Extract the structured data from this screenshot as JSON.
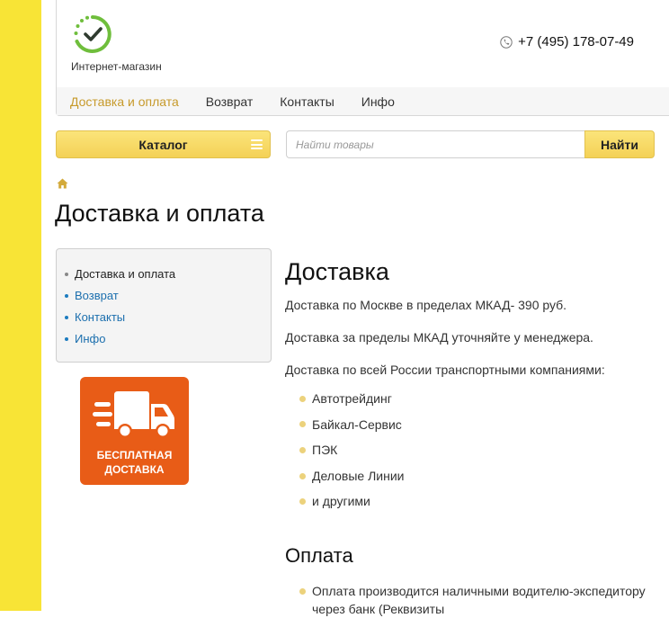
{
  "header": {
    "logo_caption": "Интернет-магазин",
    "phone": "+7 (495) 178-07-49"
  },
  "nav": {
    "items": [
      {
        "label": "Доставка и оплата",
        "active": true
      },
      {
        "label": "Возврат",
        "active": false
      },
      {
        "label": "Контакты",
        "active": false
      },
      {
        "label": "Инфо",
        "active": false
      }
    ]
  },
  "toolbar": {
    "catalog_label": "Каталог",
    "search_placeholder": "Найти товары",
    "search_button": "Найти"
  },
  "page": {
    "title": "Доставка и оплата"
  },
  "sidebar": {
    "items": [
      {
        "label": "Доставка и оплата",
        "active": true
      },
      {
        "label": "Возврат",
        "active": false
      },
      {
        "label": "Контакты",
        "active": false
      },
      {
        "label": "Инфо",
        "active": false
      }
    ]
  },
  "banner": {
    "line1": "БЕСПЛАТНАЯ",
    "line2": "ДОСТАВКА"
  },
  "content": {
    "delivery_heading": "Доставка",
    "p1": "Доставка по Москве в пределах МКАД- 390 руб.",
    "p2": "Доставка за пределы МКАД уточняйте у менеджера.",
    "p3": "Доставка по всей России транспортными компаниями:",
    "companies": [
      "Автотрейдинг",
      "Байкал-Сервис",
      "ПЭК",
      "Деловые Линии",
      "и другими"
    ],
    "payment_heading": "Оплата",
    "payment_line1": "Оплата производится наличными водителю-экспедитору",
    "payment_line2": "через банк (Реквизиты"
  },
  "colors": {
    "accent_yellow": "#f8e436",
    "button_yellow": "#f4d156",
    "link_blue": "#1c6fae",
    "nav_active": "#c79a2b",
    "banner_orange": "#e85c17",
    "logo_green": "#6fbe3c"
  },
  "icons": {
    "logo": "check-circle-icon",
    "phone": "phone-icon",
    "catalog": "burger-icon",
    "home": "home-icon",
    "banner": "truck-icon"
  }
}
